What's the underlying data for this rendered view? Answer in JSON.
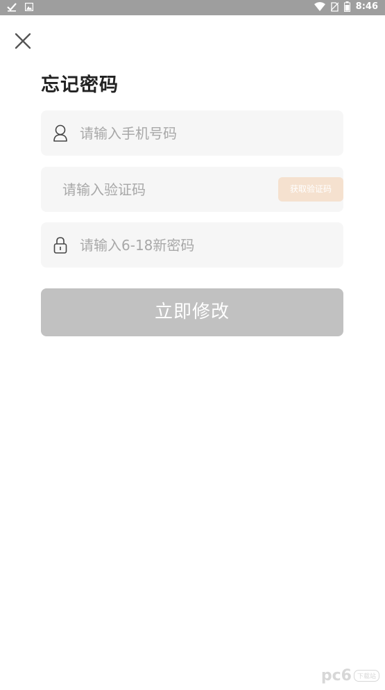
{
  "status_bar": {
    "time": "8:46",
    "icons": [
      "check-icon",
      "image-icon",
      "wifi-icon",
      "no-sim-icon",
      "battery-icon"
    ]
  },
  "page": {
    "title": "忘记密码",
    "close_icon": "close-icon"
  },
  "phone_field": {
    "icon": "user-icon",
    "placeholder": "请输入手机号码"
  },
  "code_field": {
    "placeholder": "请输入验证码",
    "get_code_label": "获取验证码"
  },
  "password_field": {
    "icon": "lock-icon",
    "placeholder": "请输入6-18新密码"
  },
  "submit": {
    "label": "立即修改"
  },
  "watermark": {
    "brand": "pc6",
    "sub": "下载站"
  },
  "colors": {
    "status_bar": "#9e9e9e",
    "field_bg": "#f6f6f6",
    "get_code_bg": "#f5e1cf",
    "submit_bg": "#c1c1c1",
    "title_text": "#222222",
    "placeholder_text": "#a8a8a8"
  }
}
